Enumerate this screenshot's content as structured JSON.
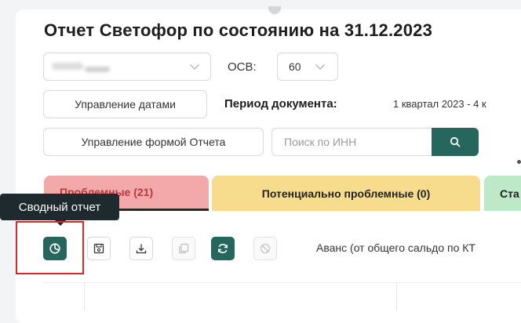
{
  "title": "Отчет Светофор по состоянию на 31.12.2023",
  "filters": {
    "osv_label": "ОСВ:",
    "osv_value": "60"
  },
  "buttons": {
    "manage_dates": "Управление датами",
    "manage_form": "Управление формой Отчета"
  },
  "period": {
    "label": "Период документа:",
    "value": "1 квартал 2023 - 4 к"
  },
  "search": {
    "placeholder": "Поиск по ИНН"
  },
  "tabs": {
    "problem": "Проблемные (21)",
    "potential": "Потенциально проблемные (0)",
    "stable": "Ста"
  },
  "tooltip": "Сводный отчет",
  "toolbar": {
    "icons": [
      "pie-chart-icon",
      "save-icon",
      "download-icon",
      "copy-icon",
      "refresh-icon",
      "cancel-icon"
    ],
    "advance_text": "Аванс (от общего сальдо по КТ"
  },
  "colors": {
    "accent": "#25665d",
    "tab_problem": "#f3a8a9",
    "tab_potential": "#f8dc8e",
    "tab_stable": "#bde9c9",
    "highlight": "#e0262b"
  }
}
